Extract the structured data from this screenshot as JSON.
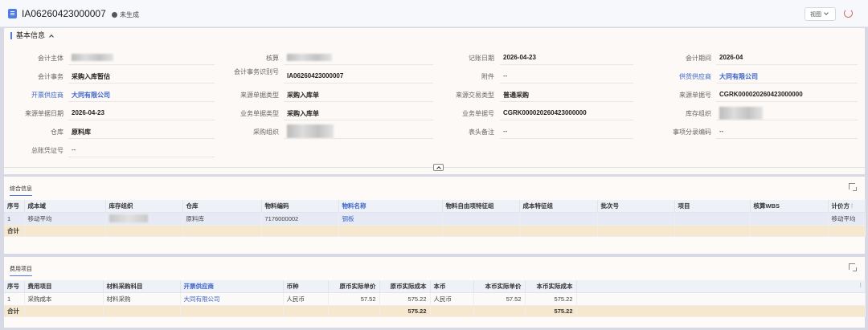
{
  "header": {
    "doc_no": "IA06260423000007",
    "status": "未生成",
    "view_label": "视图"
  },
  "basic": {
    "title": "基本信息",
    "fields": [
      {
        "label": "会计主体",
        "value": ""
      },
      {
        "label": "核算",
        "value": ""
      },
      {
        "label": "记账日期",
        "value": "2026-04-23"
      },
      {
        "label": "会计期间",
        "value": "2026-04"
      },
      {
        "label": "会计事务",
        "value": "采购入库暂估"
      },
      {
        "label": "会计事务识别号",
        "value": "IA06260423000007"
      },
      {
        "label": "附件",
        "value": "--"
      },
      {
        "label": "供货供应商",
        "value": "大同有限公司"
      },
      {
        "label": "开票供应商",
        "value": "大同有限公司"
      },
      {
        "label": "来源单据类型",
        "value": "采购入库单"
      },
      {
        "label": "来源交易类型",
        "value": "普通采购"
      },
      {
        "label": "来源单据号",
        "value": "CGRK000020260423000000"
      },
      {
        "label": "来源单据日期",
        "value": "2026-04-23"
      },
      {
        "label": "业务单据类型",
        "value": "采购入库单"
      },
      {
        "label": "业务单据号",
        "value": "CGRK000020260423000000"
      },
      {
        "label": "库存组织",
        "value": ""
      },
      {
        "label": "仓库",
        "value": "原料库"
      },
      {
        "label": "采购组织",
        "value": ""
      },
      {
        "label": "表头备注",
        "value": "--"
      },
      {
        "label": "事项分录编码",
        "value": "--"
      },
      {
        "label": "总账凭证号",
        "value": "--"
      }
    ]
  },
  "detail": {
    "tab": "综合信息",
    "columns": [
      "序号",
      "成本域",
      "库存组织",
      "仓库",
      "物料编码",
      "物料名称",
      "物料自由项特征组",
      "成本特征组",
      "批次号",
      "项目",
      "核算WBS",
      "计价方"
    ],
    "rows": [
      [
        "1",
        "移动平均",
        "",
        "原料库",
        "7176000002",
        "钢板",
        "",
        "",
        "",
        "",
        "",
        "移动平均"
      ]
    ],
    "sum_label": "合计"
  },
  "fees": {
    "tab": "费用项目",
    "columns": [
      "序号",
      "费用项目",
      "材料采购科目",
      "开票供应商",
      "币种",
      "原币实际单价",
      "原币实际成本",
      "本币",
      "本币实际单价",
      "本币实际成本"
    ],
    "rows": [
      [
        "1",
        "采购成本",
        "材料采购",
        "大同有限公司",
        "人民币",
        "57.52",
        "575.22",
        "人民币",
        "57.52",
        "575.22"
      ]
    ],
    "sum_label": "合计",
    "sum_orig_cost": "575.22",
    "sum_local_cost": "575.22"
  }
}
